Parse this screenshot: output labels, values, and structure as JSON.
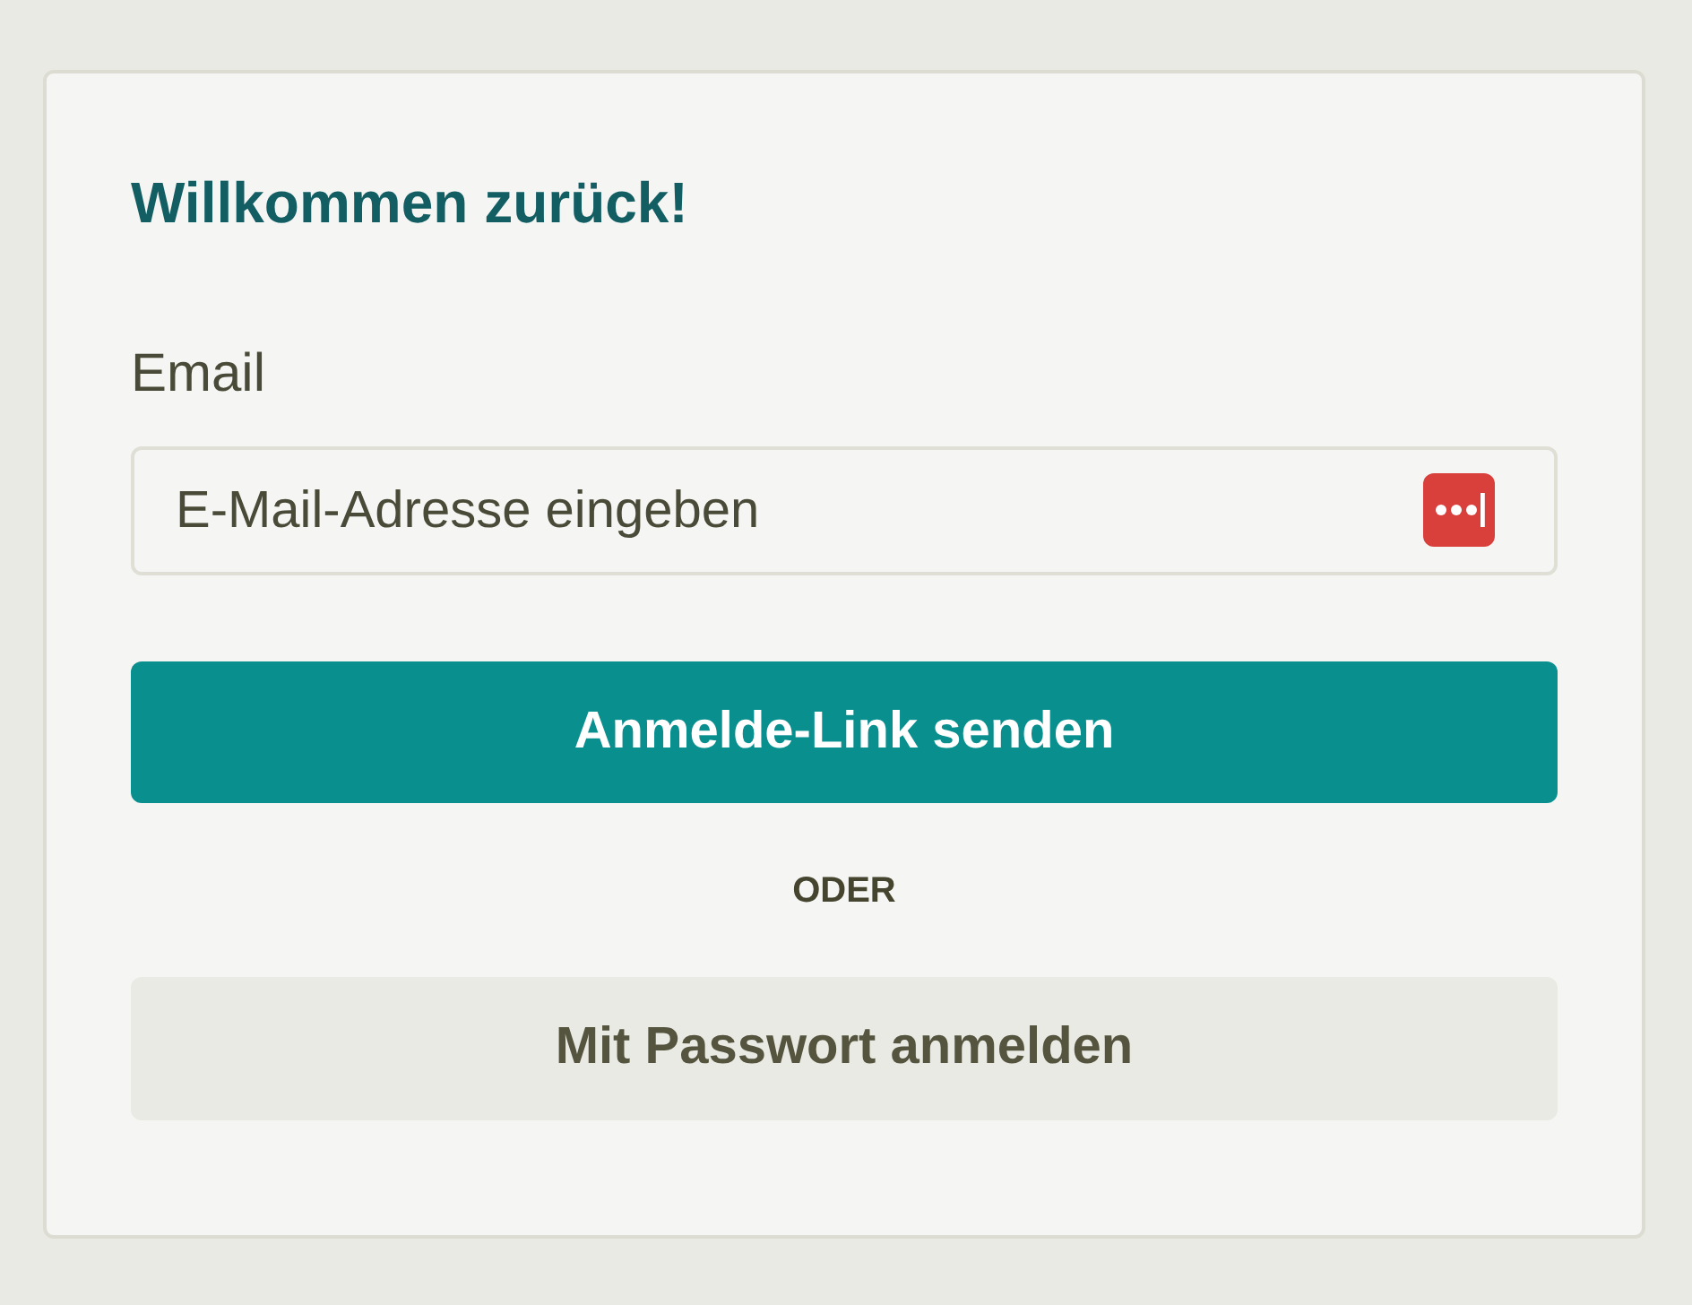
{
  "card": {
    "title": "Willkommen zurück!",
    "email_field": {
      "label": "Email",
      "placeholder": "E-Mail-Adresse eingeben"
    },
    "buttons": [
      {
        "kind": "primary",
        "label": "Anmelde-Link senden"
      },
      {
        "kind": "divider",
        "label": "ODER"
      },
      {
        "kind": "secondary",
        "label": "Mit Passwort anmelden"
      }
    ]
  }
}
